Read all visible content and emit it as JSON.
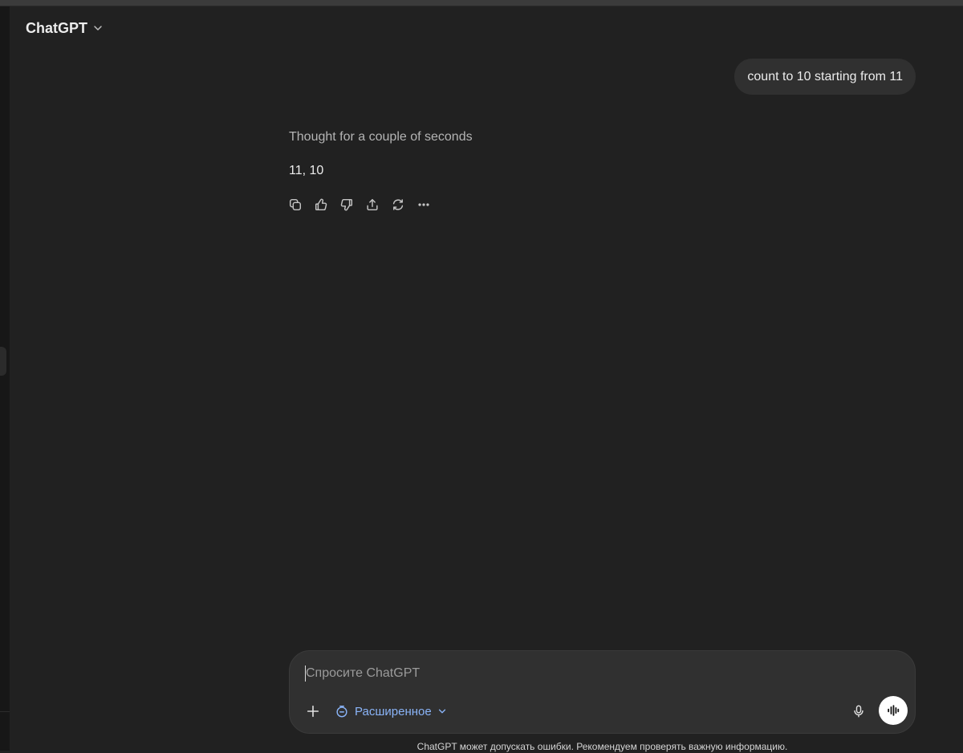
{
  "header": {
    "model_title": "ChatGPT"
  },
  "conversation": {
    "user_message": "count to 10 starting from 11",
    "assistant": {
      "thought_label": "Thought for a couple of seconds",
      "answer": "11, 10",
      "actions": [
        "copy-icon",
        "thumbs-up-icon",
        "thumbs-down-icon",
        "share-icon",
        "regenerate-icon",
        "more-icon"
      ]
    }
  },
  "composer": {
    "placeholder": "Спросите ChatGPT",
    "mode_label": "Расширенное",
    "accent_color": "#8ab4f8"
  },
  "footer": {
    "disclaimer": "ChatGPT может допускать ошибки. Рекомендуем проверять важную информацию."
  }
}
